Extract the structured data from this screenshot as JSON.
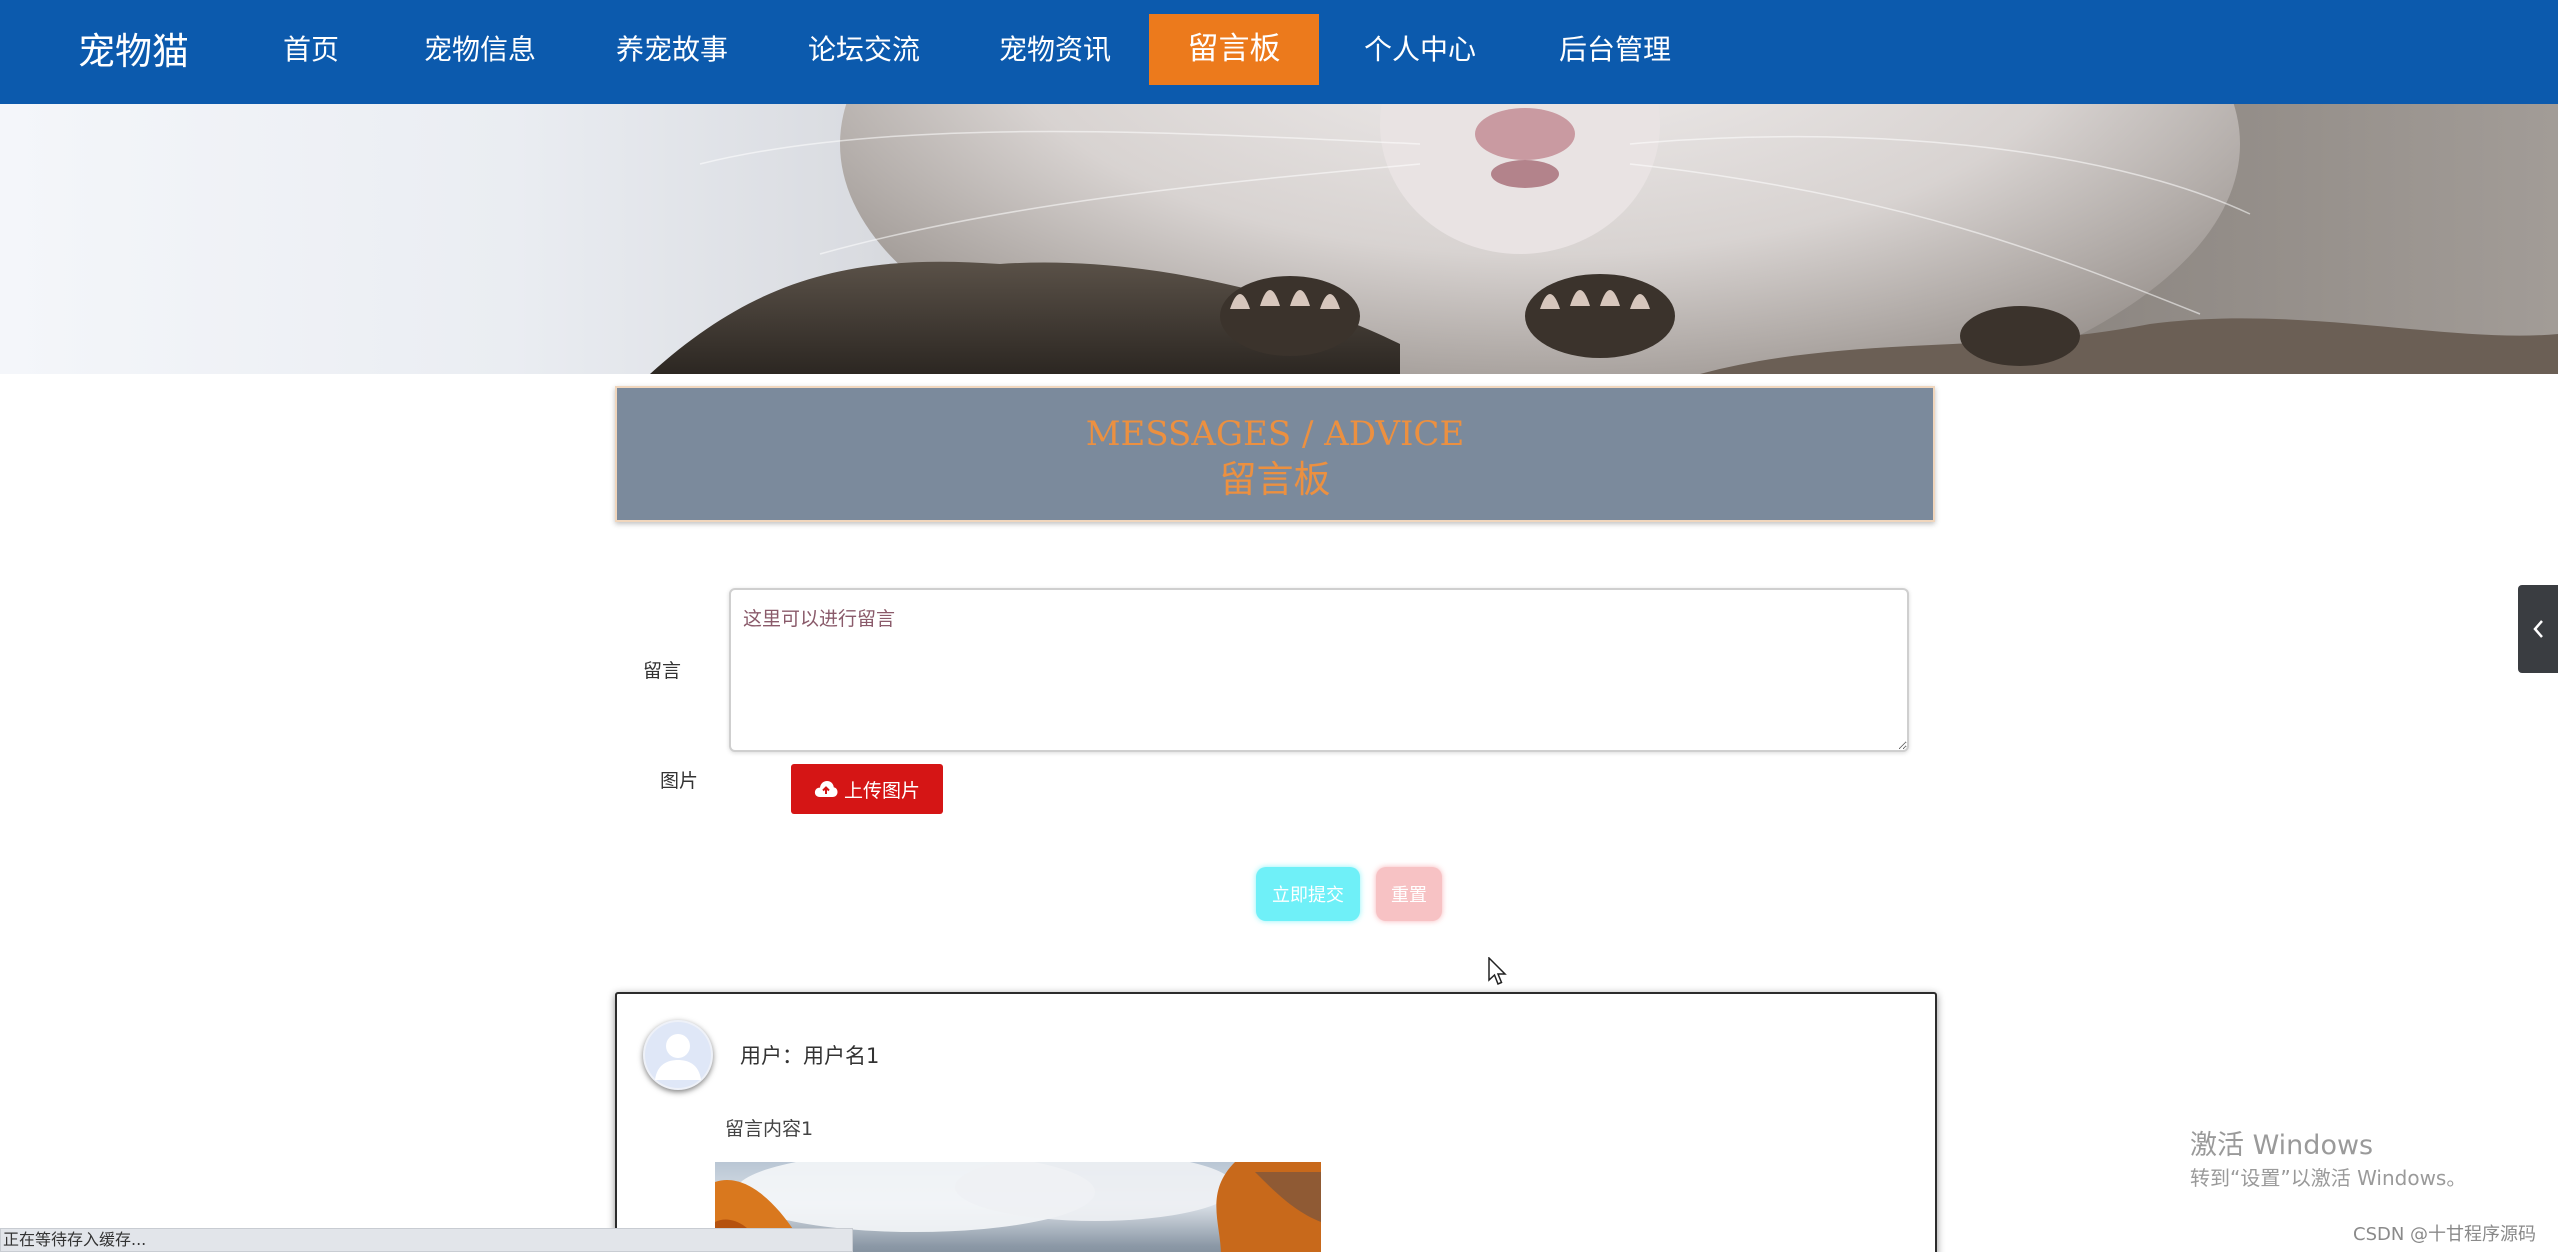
{
  "brand": "宠物猫",
  "nav": {
    "items": [
      {
        "label": "首页"
      },
      {
        "label": "宠物信息"
      },
      {
        "label": "养宠故事"
      },
      {
        "label": "论坛交流"
      },
      {
        "label": "宠物资讯"
      },
      {
        "label": "留言板",
        "active": true
      },
      {
        "label": "个人中心"
      },
      {
        "label": "后台管理"
      }
    ]
  },
  "banner": {
    "slide_count": 3,
    "active_index": 0,
    "accent_color": "#ec7a1c"
  },
  "section": {
    "title_en": "MESSAGES / ADVICE",
    "title_cn": "留言板"
  },
  "form": {
    "message_label": "留言",
    "message_placeholder": "这里可以进行留言",
    "image_label": "图片",
    "upload_label": "上传图片",
    "submit_label": "立即提交",
    "reset_label": "重置"
  },
  "messages": [
    {
      "user_prefix": "用户：",
      "username": "用户名1",
      "content": "留言内容1"
    }
  ],
  "overlay": {
    "activate_title": "激活 Windows",
    "activate_sub": "转到“设置”以激活 Windows。",
    "watermark": "CSDN @十甘程序源码",
    "status": "正在等待存入缓存..."
  },
  "colors": {
    "nav_bg": "#0c5aad",
    "nav_active": "#ec7a1c",
    "upload_btn": "#d51515",
    "submit_btn": "#6ff0f8",
    "reset_btn": "#f7c2c4",
    "title_box": "#7b8a9c",
    "title_text": "#ec9040"
  }
}
